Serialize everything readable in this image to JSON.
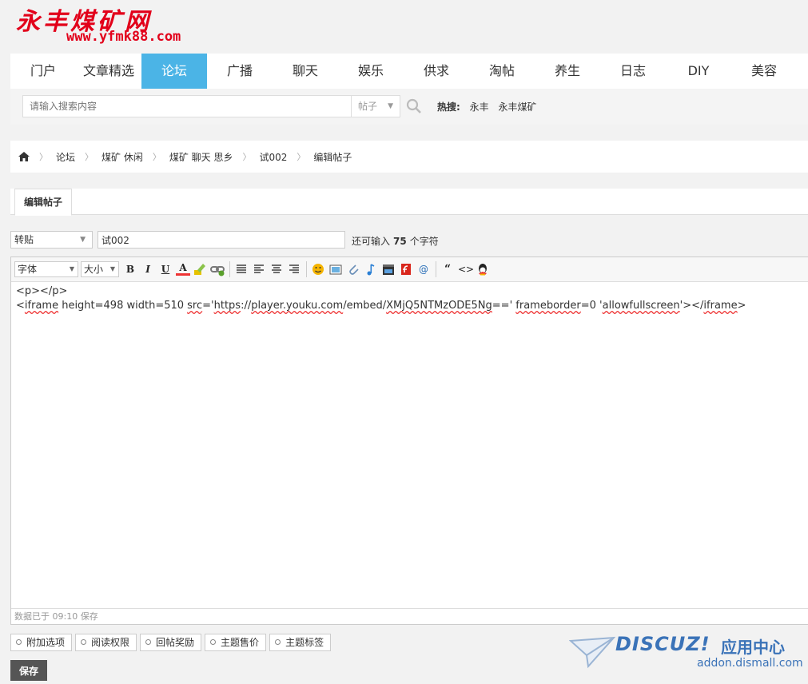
{
  "logo": {
    "name": "永丰煤矿网",
    "url": "www.yfmk88.com"
  },
  "nav": [
    {
      "label": "门户",
      "active": false
    },
    {
      "label": "文章精选",
      "active": false
    },
    {
      "label": "论坛",
      "active": true
    },
    {
      "label": "广播",
      "active": false
    },
    {
      "label": "聊天",
      "active": false
    },
    {
      "label": "娱乐",
      "active": false
    },
    {
      "label": "供求",
      "active": false
    },
    {
      "label": "淘帖",
      "active": false
    },
    {
      "label": "养生",
      "active": false
    },
    {
      "label": "日志",
      "active": false
    },
    {
      "label": "DIY",
      "active": false
    },
    {
      "label": "美容",
      "active": false
    }
  ],
  "search": {
    "placeholder": "请输入搜索内容",
    "type": "帖子",
    "hot_label": "热搜:",
    "hot_terms": [
      "永丰",
      "永丰煤矿"
    ]
  },
  "breadcrumb": [
    "论坛",
    "煤矿 休闲",
    "煤矿 聊天 思乡",
    "试002",
    "编辑帖子"
  ],
  "tab": "编辑帖子",
  "post": {
    "type": "转贴",
    "title": "试002",
    "remaining_prefix": "还可输入",
    "remaining": "75",
    "remaining_suffix": "个字符"
  },
  "toolbar": {
    "font": "字体",
    "size": "大小"
  },
  "editor": {
    "line1": "<p></p>",
    "line2_parts": [
      "<",
      "iframe",
      " height=498 width=510 ",
      "src",
      "='",
      "https",
      "://",
      "player.youku.com",
      "/embed/",
      "XMjQ5NTMzODE5Ng",
      "==' ",
      "frameborder",
      "=0 '",
      "allowfullscreen",
      "'></",
      "iframe",
      ">"
    ],
    "status": "数据已于 09:10 保存"
  },
  "options": [
    "附加选项",
    "阅读权限",
    "回帖奖励",
    "主题售价",
    "主题标签"
  ],
  "save_label": "保存",
  "watermark": {
    "brand": "DISCUZ!",
    "cn": "应用中心",
    "url": "addon.dismall.com"
  },
  "colors": {
    "nav_active": "#4bb4e6",
    "logo": "#e2001a",
    "watermark": "#3b73b8"
  }
}
